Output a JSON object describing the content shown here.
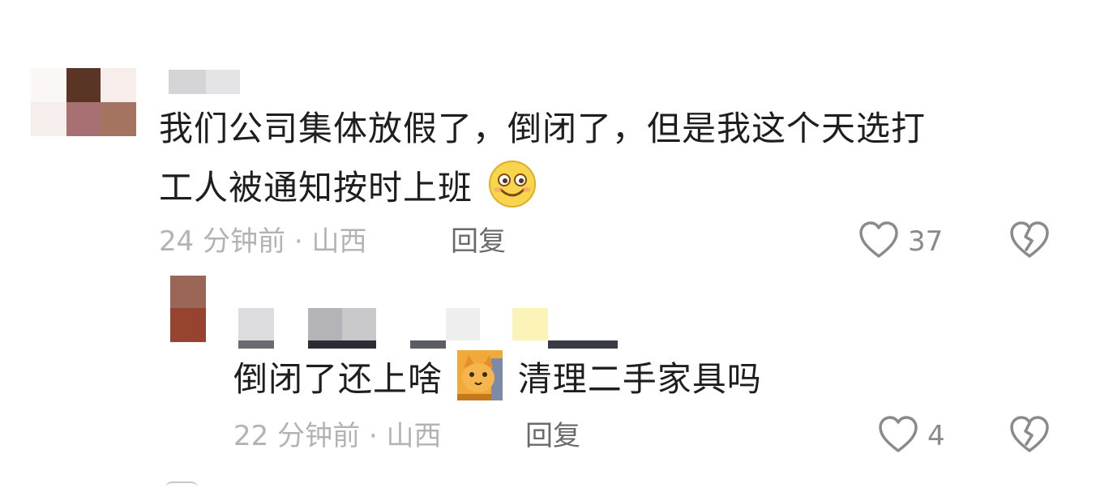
{
  "comments": [
    {
      "text_line1": "我们公司集体放假了，倒闭了，但是我这个天选打",
      "text_line2": "工人被通知按时上班",
      "emoji": "smiley-emoji",
      "time": "24 分钟前",
      "location": "山西",
      "reply_label": "回复",
      "likes": "37"
    },
    {
      "text_part1": "倒闭了还上啥",
      "emoji": "cat-emoji",
      "text_part2": "清理二手家具吗",
      "time": "22 分钟前",
      "location": "山西",
      "reply_label": "回复",
      "likes": "4"
    }
  ],
  "separator": "·",
  "icons": {
    "like": "heart-icon",
    "dislike": "broken-heart-icon"
  },
  "colors": {
    "text": "#1e1e1e",
    "meta": "#b3b3b3",
    "reply": "#6a6a6a",
    "icon": "#8a8a8a"
  }
}
